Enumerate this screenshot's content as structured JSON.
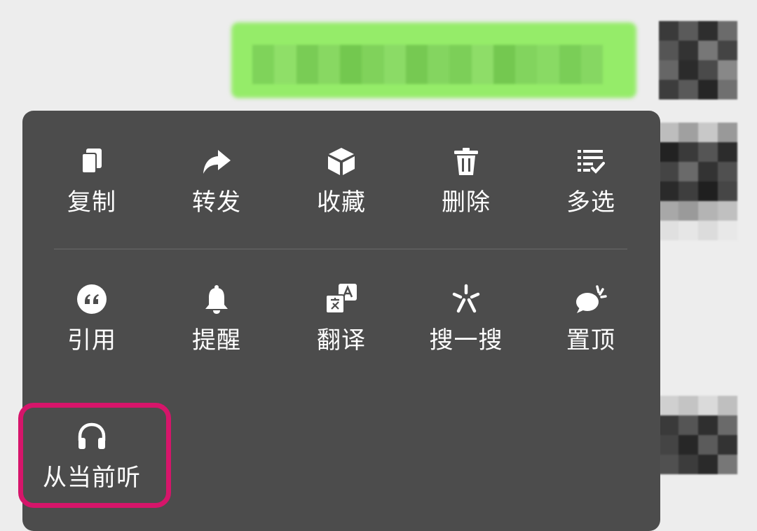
{
  "menu": {
    "row1": [
      {
        "label": "复制",
        "icon": "copy-icon"
      },
      {
        "label": "转发",
        "icon": "forward-icon"
      },
      {
        "label": "收藏",
        "icon": "favorite-icon"
      },
      {
        "label": "删除",
        "icon": "delete-icon"
      },
      {
        "label": "多选",
        "icon": "multi-select-icon"
      }
    ],
    "row2": [
      {
        "label": "引用",
        "icon": "quote-icon"
      },
      {
        "label": "提醒",
        "icon": "bell-icon"
      },
      {
        "label": "翻译",
        "icon": "translate-icon"
      },
      {
        "label": "搜一搜",
        "icon": "search-sparkle-icon"
      },
      {
        "label": "置顶",
        "icon": "pin-top-icon"
      }
    ],
    "row3": [
      {
        "label": "从当前听",
        "icon": "headphones-icon"
      }
    ]
  },
  "colors": {
    "menu_bg": "#4c4c4c",
    "bubble": "#95ec69",
    "highlight": "#d6156a",
    "background": "#ededed"
  }
}
